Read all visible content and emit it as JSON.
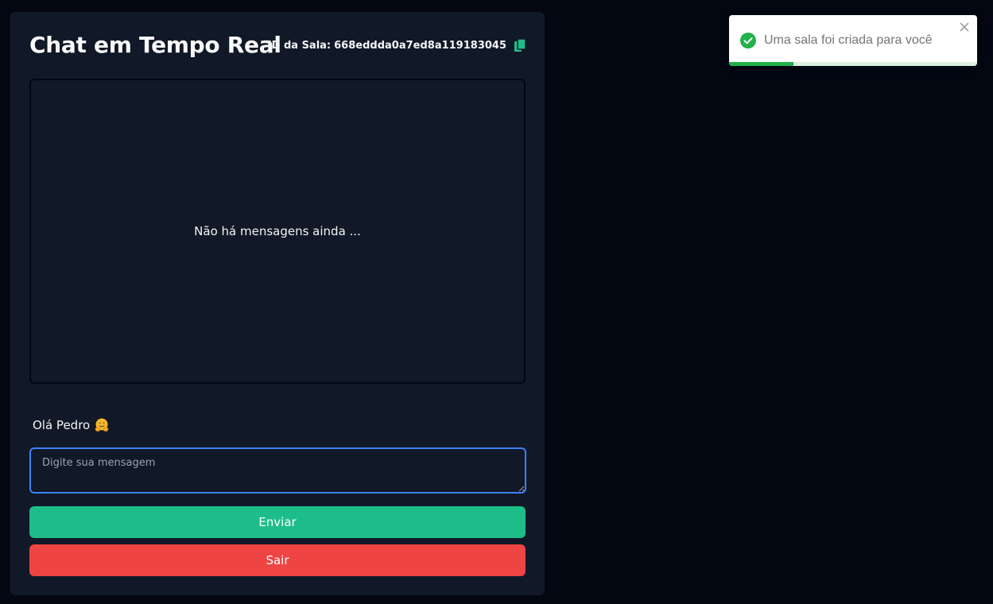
{
  "header": {
    "title": "Chat em Tempo Real",
    "room_label": "ID da Sala:",
    "room_id": "668eddda0a7ed8a119183045",
    "copy_icon": "copy-icon"
  },
  "messages": {
    "empty_text": "Não há mensagens ainda ..."
  },
  "greeting": {
    "text": "Olá Pedro",
    "icon": "hugging-face-icon"
  },
  "composer": {
    "placeholder": "Digite sua mensagem",
    "value": ""
  },
  "buttons": {
    "send_label": "Enviar",
    "leave_label": "Sair"
  },
  "toast": {
    "message": "Uma sala foi criada para você",
    "icon": "check-circle-icon",
    "close_icon": "close-icon",
    "progress": 0.26
  },
  "colors": {
    "background": "#030712",
    "panel": "#111827",
    "accent_focus": "#3b82f6",
    "send": "#1dbd89",
    "leave": "#ef4444",
    "toast_success": "#22b14c"
  }
}
